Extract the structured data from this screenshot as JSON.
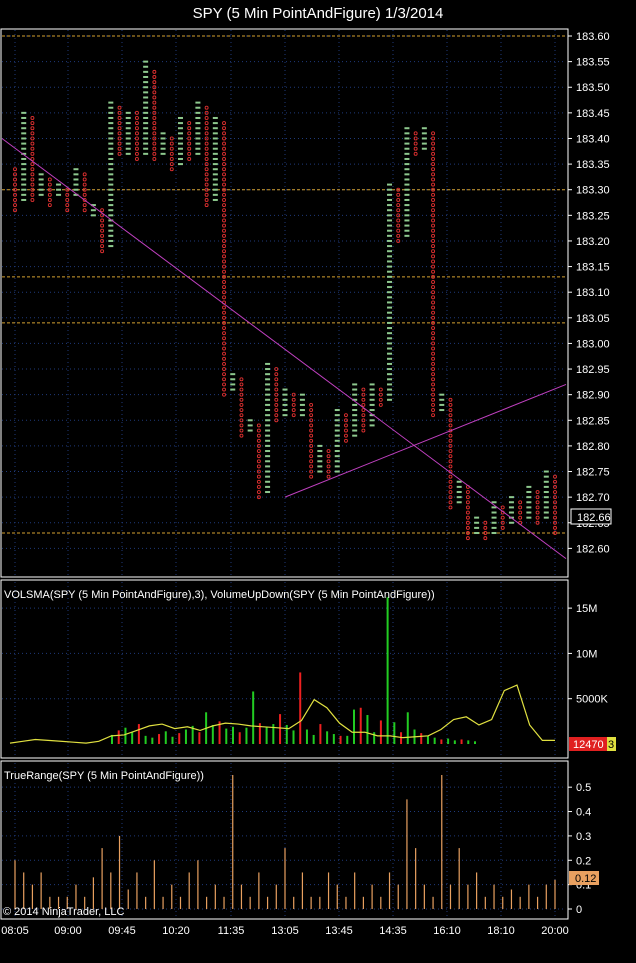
{
  "title": "SPY (5 Min PointAndFigure)  1/3/2014",
  "copyright": "© 2014 NinjaTrader, LLC",
  "colors": {
    "background": "#000000",
    "grid": "#1f3a7a",
    "x_box": "#8ec98e",
    "o_box": "#e03030",
    "trendline": "#c040c0",
    "level_line": "#d4a030",
    "vol_up": "#22cc22",
    "vol_down": "#ee2020",
    "vol_sma": "#e0e040",
    "true_range": "#e8a060"
  },
  "x_labels": [
    "08:05",
    "09:00",
    "09:45",
    "10:20",
    "11:35",
    "13:05",
    "13:45",
    "14:35",
    "16:10",
    "18:10",
    "20:00"
  ],
  "chart_data": [
    {
      "type": "point_and_figure",
      "title": "SPY (5 Min PointAndFigure)  1/3/2014",
      "ylim": [
        182.55,
        183.6
      ],
      "y_ticks": [
        "183.60",
        "183.55",
        "183.50",
        "183.45",
        "183.40",
        "183.35",
        "183.30",
        "183.25",
        "183.20",
        "183.15",
        "183.10",
        "183.05",
        "183.00",
        "182.95",
        "182.90",
        "182.85",
        "182.80",
        "182.75",
        "182.70",
        "182.65",
        "182.60"
      ],
      "last_price": "182.66",
      "horizontal_levels": [
        183.6,
        183.3,
        183.13,
        183.04,
        182.63
      ],
      "trendlines": [
        {
          "from": [
            "08:05",
            183.4
          ],
          "to": [
            "20:00",
            182.58
          ]
        },
        {
          "from": [
            "13:05",
            182.7
          ],
          "to": [
            "20:00",
            182.92
          ]
        }
      ],
      "columns": [
        {
          "kind": "O",
          "high": 183.34,
          "low": 183.26
        },
        {
          "kind": "X",
          "high": 183.45,
          "low": 183.28
        },
        {
          "kind": "O",
          "high": 183.44,
          "low": 183.28
        },
        {
          "kind": "X",
          "high": 183.33,
          "low": 183.29
        },
        {
          "kind": "O",
          "high": 183.32,
          "low": 183.27
        },
        {
          "kind": "X",
          "high": 183.31,
          "low": 183.29
        },
        {
          "kind": "O",
          "high": 183.3,
          "low": 183.26
        },
        {
          "kind": "X",
          "high": 183.34,
          "low": 183.29
        },
        {
          "kind": "O",
          "high": 183.33,
          "low": 183.26
        },
        {
          "kind": "X",
          "high": 183.27,
          "low": 183.25
        },
        {
          "kind": "O",
          "high": 183.26,
          "low": 183.18
        },
        {
          "kind": "X",
          "high": 183.47,
          "low": 183.19
        },
        {
          "kind": "O",
          "high": 183.46,
          "low": 183.37
        },
        {
          "kind": "X",
          "high": 183.45,
          "low": 183.37
        },
        {
          "kind": "O",
          "high": 183.45,
          "low": 183.36
        },
        {
          "kind": "X",
          "high": 183.55,
          "low": 183.37
        },
        {
          "kind": "O",
          "high": 183.53,
          "low": 183.36
        },
        {
          "kind": "X",
          "high": 183.41,
          "low": 183.37
        },
        {
          "kind": "O",
          "high": 183.4,
          "low": 183.34
        },
        {
          "kind": "X",
          "high": 183.44,
          "low": 183.35
        },
        {
          "kind": "O",
          "high": 183.43,
          "low": 183.36
        },
        {
          "kind": "X",
          "high": 183.47,
          "low": 183.37
        },
        {
          "kind": "O",
          "high": 183.46,
          "low": 183.27
        },
        {
          "kind": "X",
          "high": 183.44,
          "low": 183.28
        },
        {
          "kind": "O",
          "high": 183.43,
          "low": 182.9
        },
        {
          "kind": "X",
          "high": 182.94,
          "low": 182.91
        },
        {
          "kind": "O",
          "high": 182.93,
          "low": 182.82
        },
        {
          "kind": "X",
          "high": 182.85,
          "low": 182.83
        },
        {
          "kind": "O",
          "high": 182.84,
          "low": 182.7
        },
        {
          "kind": "X",
          "high": 182.96,
          "low": 182.71
        },
        {
          "kind": "O",
          "high": 182.95,
          "low": 182.85
        },
        {
          "kind": "X",
          "high": 182.91,
          "low": 182.86
        },
        {
          "kind": "O",
          "high": 182.9,
          "low": 182.86
        },
        {
          "kind": "X",
          "high": 182.9,
          "low": 182.86
        },
        {
          "kind": "O",
          "high": 182.88,
          "low": 182.74
        },
        {
          "kind": "X",
          "high": 182.8,
          "low": 182.75
        },
        {
          "kind": "O",
          "high": 182.79,
          "low": 182.74
        },
        {
          "kind": "X",
          "high": 182.87,
          "low": 182.75
        },
        {
          "kind": "O",
          "high": 182.86,
          "low": 182.81
        },
        {
          "kind": "X",
          "high": 182.92,
          "low": 182.82
        },
        {
          "kind": "O",
          "high": 182.91,
          "low": 182.83
        },
        {
          "kind": "X",
          "high": 182.92,
          "low": 182.84
        },
        {
          "kind": "O",
          "high": 182.91,
          "low": 182.88
        },
        {
          "kind": "X",
          "high": 183.31,
          "low": 182.89
        },
        {
          "kind": "O",
          "high": 183.3,
          "low": 183.2
        },
        {
          "kind": "X",
          "high": 183.42,
          "low": 183.21
        },
        {
          "kind": "O",
          "high": 183.41,
          "low": 183.37
        },
        {
          "kind": "X",
          "high": 183.42,
          "low": 183.38
        },
        {
          "kind": "O",
          "high": 183.41,
          "low": 182.86
        },
        {
          "kind": "X",
          "high": 182.9,
          "low": 182.87
        },
        {
          "kind": "O",
          "high": 182.89,
          "low": 182.68
        },
        {
          "kind": "X",
          "high": 182.73,
          "low": 182.69
        },
        {
          "kind": "O",
          "high": 182.72,
          "low": 182.62
        },
        {
          "kind": "X",
          "high": 182.66,
          "low": 182.63
        },
        {
          "kind": "O",
          "high": 182.65,
          "low": 182.62
        },
        {
          "kind": "X",
          "high": 182.69,
          "low": 182.63
        },
        {
          "kind": "O",
          "high": 182.68,
          "low": 182.64
        },
        {
          "kind": "X",
          "high": 182.7,
          "low": 182.65
        },
        {
          "kind": "O",
          "high": 182.69,
          "low": 182.65
        },
        {
          "kind": "X",
          "high": 182.72,
          "low": 182.66
        },
        {
          "kind": "O",
          "high": 182.71,
          "low": 182.65
        },
        {
          "kind": "X",
          "high": 182.75,
          "low": 182.66
        },
        {
          "kind": "O",
          "high": 182.74,
          "low": 182.63
        }
      ]
    },
    {
      "type": "bar",
      "title": "VOLSMA(SPY (5 Min PointAndFigure),3), VolumeUpDown(SPY (5 Min PointAndFigure))",
      "ylim": [
        0,
        17000000
      ],
      "y_ticks": [
        "15M",
        "10M",
        "5000K"
      ],
      "last_value": "12470",
      "last_value_suffix": "3",
      "volume": [
        1000000,
        1500000,
        1800000,
        1300000,
        2200000,
        900000,
        700000,
        1100000,
        1400000,
        800000,
        1200000,
        1600000,
        2000000,
        1300000,
        3500000,
        2100000,
        2500000,
        1700000,
        1900000,
        1300000,
        1800000,
        5800000,
        2300000,
        1900000,
        2200000,
        3300000,
        2100000,
        1500000,
        7900000,
        1600000,
        1000000,
        2200000,
        1400000,
        1100000,
        900000,
        900000,
        3800000,
        4000000,
        3200000,
        1300000,
        2600000,
        16200000,
        2400000,
        1300000,
        3500000,
        1600000,
        1200000,
        900000,
        700000,
        500000,
        600000,
        400000,
        500000,
        400000,
        300000
      ],
      "sma": [
        100000,
        300000,
        500000,
        400000,
        300000,
        200000,
        100000,
        300000,
        900000,
        1000000,
        1500000,
        2000000,
        2200000,
        1700000,
        1900000,
        1500000,
        2000000,
        2300000,
        2200000,
        2000000,
        1900000,
        1800000,
        1700000,
        2600000,
        4900000,
        4000000,
        2300000,
        1300000,
        1300000,
        900000,
        900000,
        700000,
        800000,
        900000,
        1600000,
        2700000,
        3000000,
        2100000,
        2700000,
        5900000,
        6500000,
        2100000,
        400000,
        400000
      ]
    },
    {
      "type": "bar",
      "title": "TrueRange(SPY (5 Min PointAndFigure))",
      "ylim": [
        0,
        0.55
      ],
      "y_ticks": [
        "0.5",
        "0.4",
        "0.3",
        "0.2",
        "0.1",
        "0"
      ],
      "last_value": "0.12",
      "values": [
        0.2,
        0.15,
        0.1,
        0.15,
        0.05,
        0.05,
        0.05,
        0.1,
        0.05,
        0.13,
        0.25,
        0.15,
        0.3,
        0.08,
        0.15,
        0.05,
        0.2,
        0.05,
        0.1,
        0.05,
        0.15,
        0.2,
        0.05,
        0.1,
        0.05,
        0.55,
        0.1,
        0.05,
        0.15,
        0.05,
        0.1,
        0.25,
        0.05,
        0.15,
        0.05,
        0.05,
        0.15,
        0.1,
        0.05,
        0.15,
        0.05,
        0.1,
        0.05,
        0.15,
        0.1,
        0.45,
        0.25,
        0.1,
        0.05,
        0.55,
        0.1,
        0.25,
        0.1,
        0.15,
        0.05,
        0.1,
        0.05,
        0.08,
        0.05,
        0.1,
        0.05,
        0.1,
        0.12
      ]
    }
  ]
}
